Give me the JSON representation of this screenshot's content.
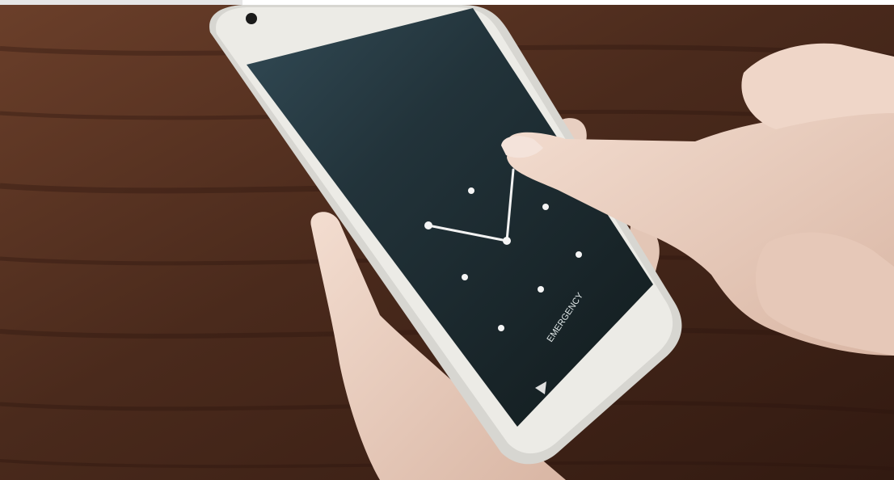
{
  "lock_screen": {
    "emergency_label": "EMERGENCY",
    "pattern_grid": {
      "rows": 3,
      "cols": 3,
      "visible_dots": [
        1,
        2,
        3,
        4,
        5,
        6,
        7
      ],
      "drawn_path": [
        3,
        4,
        1
      ]
    }
  },
  "colors": {
    "table_wood": "#4a2a1c",
    "phone_body": "#e9e8e3",
    "screen": "#1d2a2c",
    "pattern_line": "#f2f2f2",
    "skin": "#efd6c8"
  },
  "icons": {
    "back_button": "triangle-back-icon",
    "front_camera": "camera-dot-icon"
  }
}
